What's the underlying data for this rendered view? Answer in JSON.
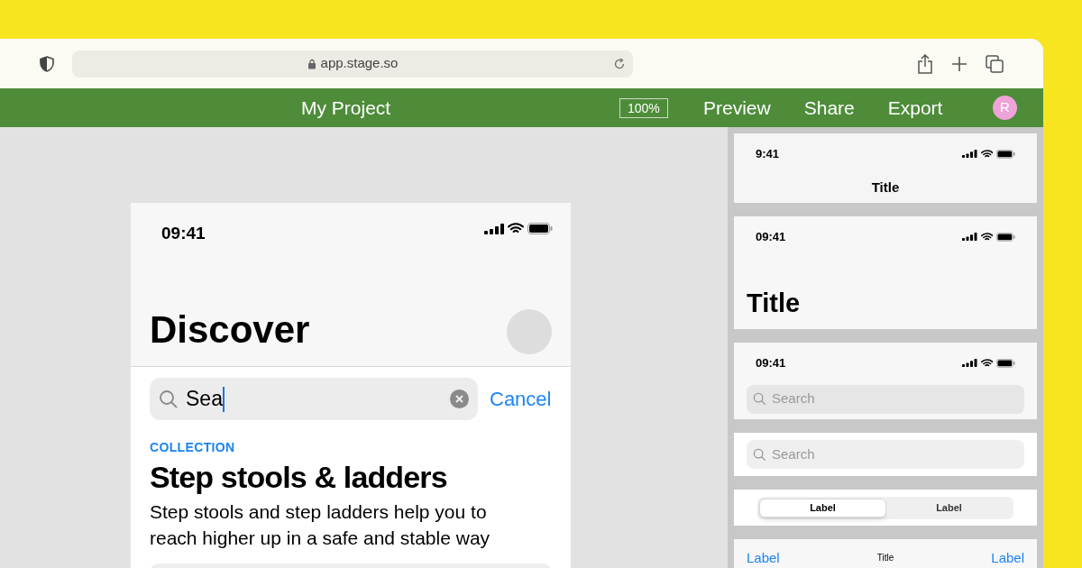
{
  "browser": {
    "url": "app.stage.so"
  },
  "app_bar": {
    "title": "My Project",
    "zoom": "100%",
    "actions": [
      "Preview",
      "Share",
      "Export"
    ],
    "avatar": "R"
  },
  "phone": {
    "time": "09:41",
    "large_title": "Discover",
    "search": {
      "value": "Sea",
      "focused": true
    },
    "cancel": "Cancel",
    "eyebrow": "COLLECTION",
    "heading": "Step stools & ladders",
    "body": "Step stools and step ladders help you to reach higher up in a safe and stable way"
  },
  "components": [
    {
      "kind": "nav_small",
      "time": "9:41",
      "title": "Title"
    },
    {
      "kind": "nav_large",
      "time": "09:41",
      "title": "Title"
    },
    {
      "kind": "nav_search",
      "time": "09:41",
      "placeholder": "Search"
    },
    {
      "kind": "search",
      "placeholder": "Search"
    },
    {
      "kind": "segmented",
      "segments": [
        {
          "label": "Label",
          "selected": true
        },
        {
          "label": "Label",
          "selected": false
        }
      ]
    },
    {
      "kind": "toolbar",
      "left": "Label",
      "title": "Title",
      "right": "Label"
    }
  ]
}
